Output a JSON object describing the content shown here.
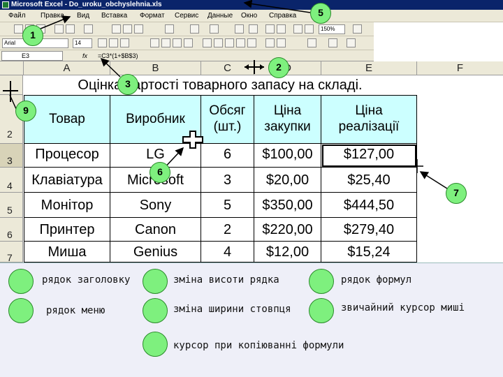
{
  "window": {
    "title": "Microsoft Excel - Do_uroku_obchyslehnia.xls"
  },
  "menu": [
    "Файл",
    "Правка",
    "Вид",
    "Вставка",
    "Формат",
    "Сервис",
    "Данные",
    "Окно",
    "Справка"
  ],
  "toolbar": {
    "font": "Arial",
    "size": "14",
    "zoom": "150%"
  },
  "formula_bar": {
    "name_box": "E3",
    "fx": "fx",
    "formula": "=C3*(1+$B$3)"
  },
  "columns": [
    "A",
    "B",
    "C",
    "D",
    "E",
    "F"
  ],
  "sheet": {
    "title": "Оцінка вартості товарного запасу на складі.",
    "header": {
      "a": "Товар",
      "b": "Виробник",
      "c": "Обсяг (шт.)",
      "d": "Ціна закупки",
      "e": "Ціна реалізації"
    },
    "row_numbers": [
      "2",
      "3",
      "4",
      "5",
      "6",
      "7"
    ],
    "rows": [
      {
        "a": "Процесор",
        "b": "LG",
        "c": "6",
        "d": "$100,00",
        "e": "$127,00"
      },
      {
        "a": "Клавіатура",
        "b": "Microsoft",
        "c": "3",
        "d": "$20,00",
        "e": "$25,40"
      },
      {
        "a": "Монітор",
        "b": "Sony",
        "c": "5",
        "d": "$350,00",
        "e": "$444,50"
      },
      {
        "a": "Принтер",
        "b": "Canon",
        "c": "2",
        "d": "$220,00",
        "e": "$279,40"
      },
      {
        "a": "Миша",
        "b": "Genius",
        "c": "4",
        "d": "$12,00",
        "e": "$15,24"
      }
    ]
  },
  "badges": [
    "1",
    "2",
    "3",
    "5",
    "6",
    "7",
    "9"
  ],
  "legend": {
    "title_row": "рядок заголовку",
    "menu_row": "рядок меню",
    "row_height": "зміна висоти рядка",
    "col_width": "зміна ширини стовпця",
    "copy_cursor": "курсор при копіюванні формули",
    "formula_row": "рядок формул",
    "mouse_cursor": "звичайний курсор миші"
  },
  "colors": {
    "header_fill": "#ccffff",
    "badge": "#7ef07e",
    "legend_bg": "#eeeff8"
  }
}
